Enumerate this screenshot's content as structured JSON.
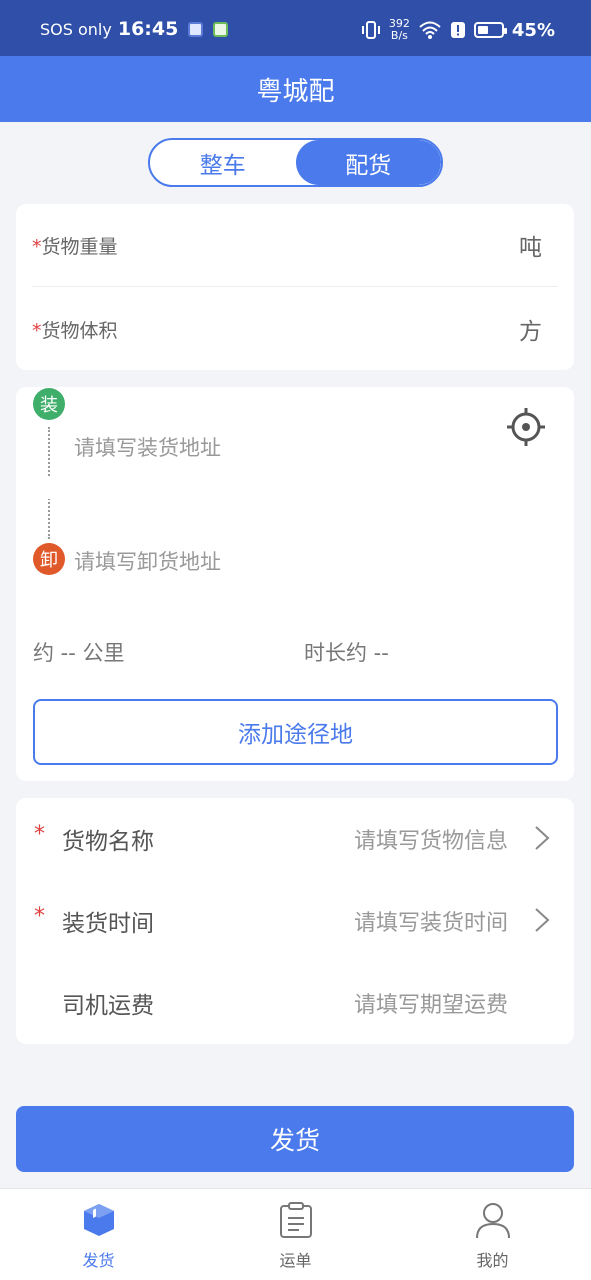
{
  "status_bar": {
    "sos": "SOS only",
    "time": "16:45",
    "speed_top": "392",
    "speed_bottom": "B/s",
    "battery": "45%",
    "battery_level": 0.45
  },
  "header": {
    "title": "粤城配"
  },
  "segment": {
    "items": [
      "整车",
      "配货"
    ],
    "active_index": 1
  },
  "cargo": {
    "weight_label": "货物重量",
    "weight_unit": "吨",
    "volume_label": "货物体积",
    "volume_unit": "方",
    "required_mark": "*"
  },
  "route": {
    "load_badge": "装",
    "unload_badge": "卸",
    "load_placeholder": "请填写装货地址",
    "unload_placeholder": "请填写卸货地址",
    "distance": "约 -- 公里",
    "duration": "时长约 --",
    "add_waypoint": "添加途径地"
  },
  "details": {
    "rows": [
      {
        "label": "货物名称",
        "value": "请填写货物信息",
        "required": true
      },
      {
        "label": "装货时间",
        "value": "请填写装货时间",
        "required": true
      },
      {
        "label": "司机运费",
        "value": "请填写期望运费",
        "required": false
      }
    ]
  },
  "submit": {
    "label": "发货"
  },
  "tabbar": {
    "tabs": [
      {
        "label": "发货",
        "icon": "box-icon"
      },
      {
        "label": "运单",
        "icon": "clipboard-icon"
      },
      {
        "label": "我的",
        "icon": "user-icon"
      }
    ],
    "active_index": 0
  },
  "colors": {
    "primary": "#4a7aeb",
    "status_bar": "#2f4fa8",
    "load": "#3fae6a",
    "unload": "#e0592a",
    "required": "#e04040"
  }
}
